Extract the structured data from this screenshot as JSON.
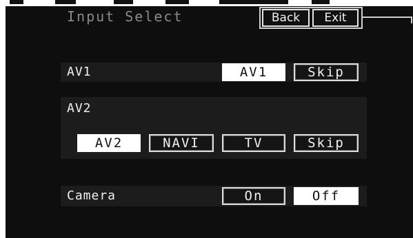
{
  "header": {
    "title": "Input Select",
    "back_label": "Back",
    "exit_label": "Exit"
  },
  "av1": {
    "label": "AV1",
    "options": [
      "AV1",
      "Skip"
    ],
    "selected": "AV1"
  },
  "av2": {
    "label": "AV2",
    "options": [
      "AV2",
      "NAVI",
      "TV",
      "Skip"
    ],
    "selected": "AV2"
  },
  "camera": {
    "label": "Camera",
    "options": [
      "On",
      "Off"
    ],
    "selected": "Off"
  },
  "colors": {
    "screen_bg": "#0e0e0e",
    "row_bg": "#1c1c1c",
    "selected_bg": "#ffffff",
    "text": "#f0f0f0",
    "title_text": "#8a8a8a"
  }
}
